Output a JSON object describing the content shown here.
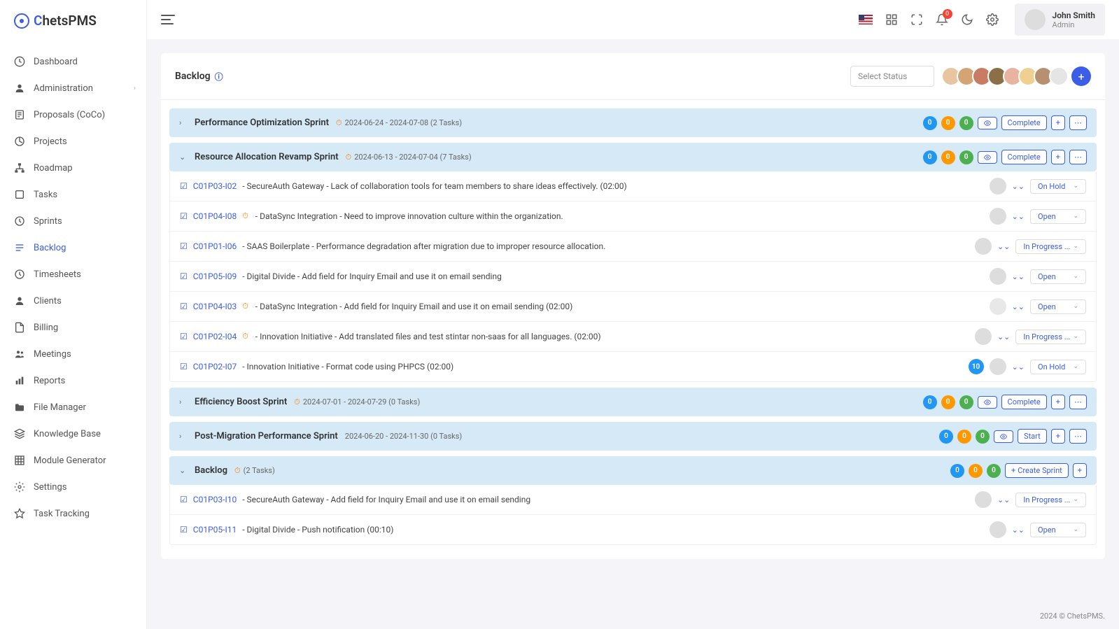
{
  "brand": {
    "name": "hetsPMS",
    "prefix": "C"
  },
  "user": {
    "name": "John Smith",
    "role": "Admin"
  },
  "notification_count": "0",
  "nav": [
    {
      "label": "Dashboard",
      "icon": "dashboard"
    },
    {
      "label": "Administration",
      "icon": "user",
      "expandable": true
    },
    {
      "label": "Proposals (CoCo)",
      "icon": "doc"
    },
    {
      "label": "Projects",
      "icon": "circle"
    },
    {
      "label": "Roadmap",
      "icon": "sitemap"
    },
    {
      "label": "Tasks",
      "icon": "square"
    },
    {
      "label": "Sprints",
      "icon": "run"
    },
    {
      "label": "Backlog",
      "icon": "list",
      "active": true
    },
    {
      "label": "Timesheets",
      "icon": "clock"
    },
    {
      "label": "Clients",
      "icon": "person"
    },
    {
      "label": "Billing",
      "icon": "file"
    },
    {
      "label": "Meetings",
      "icon": "group"
    },
    {
      "label": "Reports",
      "icon": "chart"
    },
    {
      "label": "File Manager",
      "icon": "folder"
    },
    {
      "label": "Knowledge Base",
      "icon": "stack"
    },
    {
      "label": "Module Generator",
      "icon": "grid"
    },
    {
      "label": "Settings",
      "icon": "gear"
    },
    {
      "label": "Task Tracking",
      "icon": "star"
    }
  ],
  "page": {
    "title": "Backlog",
    "status_placeholder": "Select Status"
  },
  "sprints": [
    {
      "name": "Performance Optimization Sprint",
      "dates": "2024-06-24 - 2024-07-08 (2 Tasks)",
      "clock": true,
      "expanded": false,
      "counts": [
        "0",
        "0",
        "0"
      ],
      "eye": true,
      "action": "Complete",
      "tasks": []
    },
    {
      "name": "Resource Allocation Revamp Sprint",
      "dates": "2024-06-13 - 2024-07-04 (7 Tasks)",
      "clock": true,
      "expanded": true,
      "counts": [
        "0",
        "0",
        "0"
      ],
      "eye": true,
      "action": "Complete",
      "tasks": [
        {
          "id": "C01P03-I02",
          "desc": " - SecureAuth Gateway - Lack of collaboration tools for team members to share ideas effectively. (02:00)",
          "status": "On Hold",
          "avatar": "a2"
        },
        {
          "id": "C01P04-I08",
          "clock": true,
          "desc": " - DataSync Integration - Need to improve innovation culture within the organization.",
          "status": "Open",
          "avatar": "a5"
        },
        {
          "id": "C01P01-I06",
          "desc": " - SAAS Boilerplate - Performance degradation after migration due to improper resource allocation.",
          "status": "In Progress ...",
          "avatar": "a3"
        },
        {
          "id": "C01P05-I09",
          "desc": " - Digital Divide - Add field for Inquiry Email and use it on email sending",
          "status": "Open",
          "avatar": "a5"
        },
        {
          "id": "C01P04-I03",
          "clock": true,
          "desc": " - DataSync Integration - Add field for Inquiry Email and use it on email sending (02:00)",
          "status": "Open",
          "avatar": "ghost"
        },
        {
          "id": "C01P02-I04",
          "clock": true,
          "desc": " - Innovation Initiative - Add translated files and test stintar non-saas for all languages. (02:00)",
          "status": "In Progress ...",
          "avatar": "a4"
        },
        {
          "id": "C01P02-I07",
          "desc": " - Innovation Initiative - Format code using PHPCS (02:00)",
          "status": "On Hold",
          "num": "10",
          "avatar": "a3"
        }
      ]
    },
    {
      "name": "Efficiency Boost Sprint",
      "dates": "2024-07-01 - 2024-07-29 (0 Tasks)",
      "clock": true,
      "expanded": false,
      "counts": [
        "0",
        "0",
        "0"
      ],
      "eye": true,
      "action": "Complete",
      "tasks": []
    },
    {
      "name": "Post-Migration Performance Sprint",
      "dates": "2024-06-20 - 2024-11-30 (0 Tasks)",
      "clock": false,
      "expanded": false,
      "counts": [
        "0",
        "0",
        "0"
      ],
      "eye": true,
      "action": "Start",
      "tasks": []
    },
    {
      "name": "Backlog",
      "dates": "(2 Tasks)",
      "clock": true,
      "expanded": true,
      "counts": [
        "0",
        "0",
        "0"
      ],
      "eye": false,
      "action": "Create Sprint",
      "action_plus": true,
      "no_more": true,
      "tasks": [
        {
          "id": "C01P03-I10",
          "desc": " - SecureAuth Gateway - Add field for Inquiry Email and use it on email sending",
          "status": "In Progress ...",
          "avatar": "a2"
        },
        {
          "id": "C01P05-I11",
          "desc": " - Digital Divide - Push notification (00:10)",
          "status": "Open",
          "avatar": "a3"
        }
      ]
    }
  ],
  "footer": "2024 © ChetsPMS."
}
